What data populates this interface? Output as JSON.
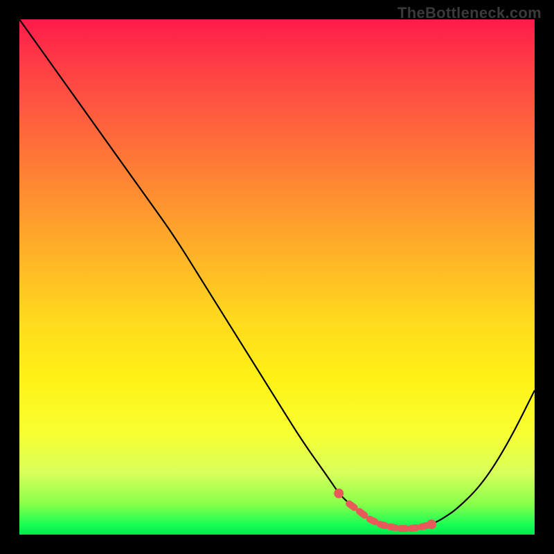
{
  "watermark": "TheBottleneck.com",
  "chart_data": {
    "type": "line",
    "title": "",
    "xlabel": "",
    "ylabel": "",
    "x": [
      0,
      5,
      10,
      15,
      20,
      25,
      30,
      35,
      40,
      45,
      50,
      55,
      60,
      62,
      64,
      66,
      68,
      70,
      72,
      74,
      76,
      78,
      80,
      82,
      85,
      90,
      95,
      100
    ],
    "values": [
      100,
      93,
      86,
      79,
      72,
      65,
      58,
      50,
      42,
      34,
      26,
      18,
      11,
      8,
      6,
      4.5,
      3,
      2,
      1.5,
      1.2,
      1.2,
      1.5,
      2,
      3,
      5,
      10,
      18,
      28
    ],
    "ylim": [
      0,
      100
    ],
    "xlim": [
      0,
      100
    ],
    "highlight_range_x": [
      62,
      80
    ],
    "annotations": []
  }
}
